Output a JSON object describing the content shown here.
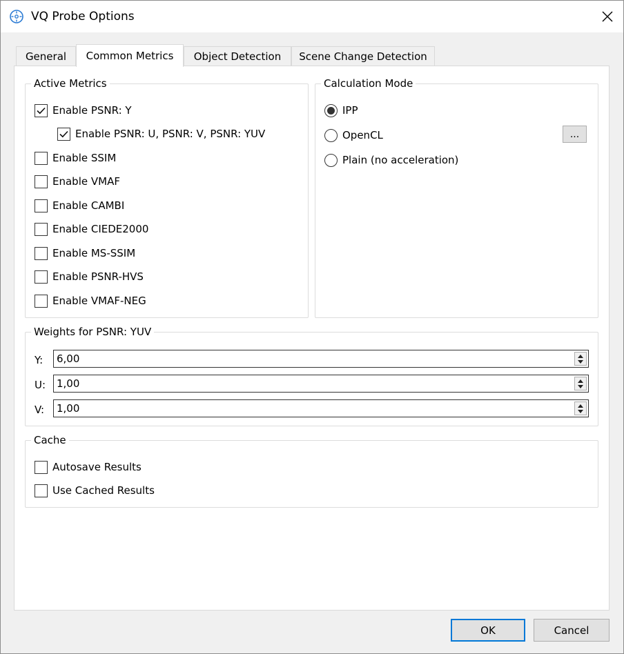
{
  "window": {
    "title": "VQ Probe Options"
  },
  "tabs": [
    {
      "label": "General"
    },
    {
      "label": "Common Metrics"
    },
    {
      "label": "Object Detection"
    },
    {
      "label": "Scene Change Detection"
    }
  ],
  "active_metrics": {
    "title": "Active Metrics",
    "items": [
      {
        "label": "Enable PSNR: Y",
        "checked": true
      },
      {
        "label": "Enable PSNR: U, PSNR: V, PSNR: YUV",
        "checked": true
      },
      {
        "label": "Enable SSIM",
        "checked": false
      },
      {
        "label": "Enable VMAF",
        "checked": false
      },
      {
        "label": "Enable CAMBI",
        "checked": false
      },
      {
        "label": "Enable CIEDE2000",
        "checked": false
      },
      {
        "label": "Enable MS-SSIM",
        "checked": false
      },
      {
        "label": "Enable PSNR-HVS",
        "checked": false
      },
      {
        "label": "Enable VMAF-NEG",
        "checked": false
      }
    ]
  },
  "calculation_mode": {
    "title": "Calculation Mode",
    "options": [
      {
        "label": "IPP",
        "selected": true
      },
      {
        "label": "OpenCL",
        "selected": false
      },
      {
        "label": "Plain (no acceleration)",
        "selected": false
      }
    ],
    "browse_label": "..."
  },
  "weights": {
    "title": "Weights for PSNR: YUV",
    "fields": [
      {
        "label": "Y:",
        "value": "6,00"
      },
      {
        "label": "U:",
        "value": "1,00"
      },
      {
        "label": "V:",
        "value": "1,00"
      }
    ]
  },
  "cache": {
    "title": "Cache",
    "items": [
      {
        "label": "Autosave Results",
        "checked": false
      },
      {
        "label": "Use Cached Results",
        "checked": false
      }
    ]
  },
  "buttons": {
    "ok": "OK",
    "cancel": "Cancel"
  },
  "colors": {
    "accent": "#0078d7",
    "icon_blue": "#2b7bd4"
  }
}
